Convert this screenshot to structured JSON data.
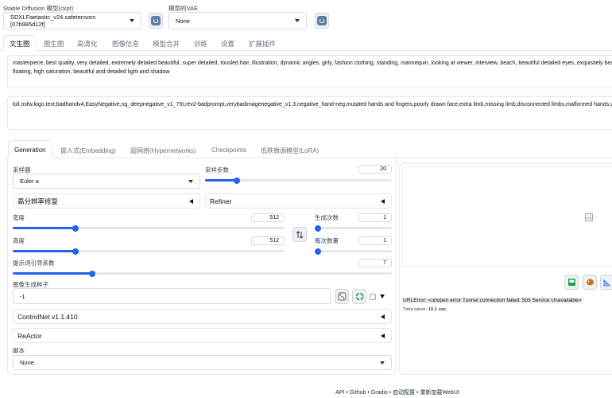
{
  "top": {
    "checkpoint_label": "Stable Diffusion 模型(ckpt)",
    "checkpoint_value": "SDXLFaetastic_v24.safetensors [07b985d12f]",
    "vae_label": "模型的VAE",
    "vae_value": "None"
  },
  "tabs": [
    "文生图",
    "图生图",
    "高清化",
    "图像信息",
    "模型合并",
    "训练",
    "设置",
    "扩展插件"
  ],
  "prompt": "masterpiece, best quality, very detailed, extremely detailed beautiful, super detailed, tousled hair, illustration, dynamic angles, girly, fashion clothing, standing, mannequin, looking at viewer, interview, beach, beautiful detailed eyes, exquisitely beautiful",
  "prompt_line2": "floating, high saturation, beautiful and detailed light and shadow",
  "negative_prompt": "loli,nsfw,logo,text,badhandv4,EasyNegative,ng_deepnegative_v1_75t,rev2-badprompt,verybadimagenegative_v1.3,negative_hand-neg,mutated hands and fingers,poorly drawn face,extra limb,missing limb,disconnected limbs,malformed hands,ugly",
  "subtabs": [
    "Generation",
    "嵌入式(Embedding)",
    "超网络(Hypernetworks)",
    "Checkpoints",
    "低秩微调模型(LoRA)"
  ],
  "sampler": {
    "label": "采样器",
    "value": "Euler a"
  },
  "steps": {
    "label": "采样步数",
    "value": "20",
    "fraction": 0.17
  },
  "hires_label": "高分辨率修复",
  "refiner_label": "Refiner",
  "width": {
    "label": "宽度",
    "value": "512",
    "fraction": 0.23
  },
  "height": {
    "label": "高度",
    "value": "512",
    "fraction": 0.23
  },
  "batch_count": {
    "label": "生成次数",
    "value": "1",
    "fraction": 0.0
  },
  "batch_size": {
    "label": "每次数量",
    "value": "1",
    "fraction": 0.0
  },
  "cfg": {
    "label": "提示词引导系数",
    "value": "7",
    "fraction": 0.21
  },
  "seed": {
    "label": "图像生成种子",
    "value": "-1"
  },
  "controlnet_label": "ControlNet v1.1.410",
  "reactor_label": "ReActor",
  "script": {
    "label": "脚本",
    "value": "None"
  },
  "output": {
    "error_text": "URLError: <urlopen error Tunnel connection failed: 503 Service Unavailable>",
    "time_label": "Time taken:",
    "time_value": "10.1 sec."
  },
  "footer": {
    "links": [
      "API",
      "Github",
      "Gradio",
      "启动配置",
      "重新加载WebUI"
    ],
    "separator": "•"
  },
  "colors": {
    "accent": "#2563eb",
    "tab_active_bg": "#ffffff",
    "page_bg": "#ffffff"
  },
  "icons": [
    "refresh-icon",
    "swap-icon",
    "dice-icon",
    "recycle-icon",
    "image-placeholder-icon",
    "save-image-icon",
    "palette-icon",
    "ruler-icon"
  ]
}
